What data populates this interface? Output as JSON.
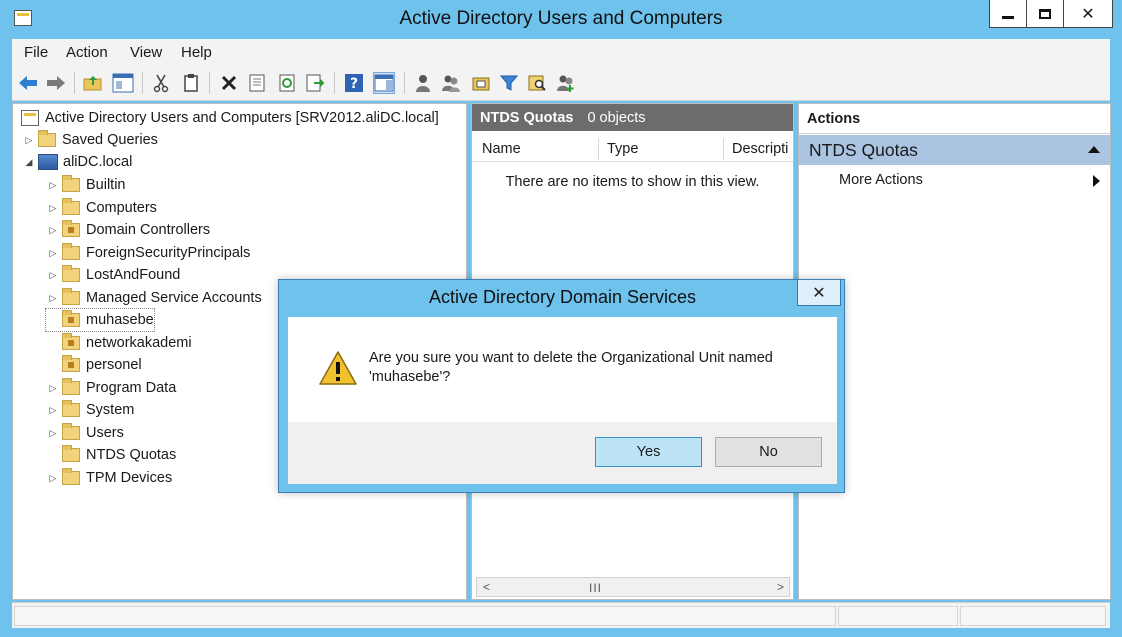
{
  "window": {
    "title": "Active Directory Users and Computers",
    "controls": {
      "minimize": "",
      "maximize": "",
      "close": "✕"
    }
  },
  "menubar": [
    "File",
    "Action",
    "View",
    "Help"
  ],
  "toolbar": {
    "icons": [
      "back-icon",
      "forward-icon",
      "up-folder-icon",
      "show-hide-console-tree-icon",
      "cut-icon",
      "copy-icon",
      "delete-icon",
      "properties-icon",
      "refresh-icon",
      "export-list-icon",
      "help-icon",
      "action-pane-icon",
      "new-user-icon",
      "new-group-icon",
      "new-ou-icon",
      "filter-icon",
      "find-icon",
      "add-to-group-icon"
    ]
  },
  "tree": {
    "root": "Active Directory Users and Computers [SRV2012.aliDC.local]",
    "saved_queries": "Saved Queries",
    "domain": "aliDC.local",
    "children": [
      {
        "label": "Builtin",
        "expandable": true,
        "ou": false
      },
      {
        "label": "Computers",
        "expandable": true,
        "ou": false
      },
      {
        "label": "Domain Controllers",
        "expandable": true,
        "ou": true
      },
      {
        "label": "ForeignSecurityPrincipals",
        "expandable": true,
        "ou": false
      },
      {
        "label": "LostAndFound",
        "expandable": true,
        "ou": false
      },
      {
        "label": "Managed Service Accounts",
        "expandable": true,
        "ou": false
      },
      {
        "label": "muhasebe",
        "expandable": false,
        "ou": true
      },
      {
        "label": "networkakademi",
        "expandable": false,
        "ou": true
      },
      {
        "label": "personel",
        "expandable": false,
        "ou": true
      },
      {
        "label": "Program Data",
        "expandable": true,
        "ou": false
      },
      {
        "label": "System",
        "expandable": true,
        "ou": false
      },
      {
        "label": "Users",
        "expandable": true,
        "ou": false
      },
      {
        "label": "NTDS Quotas",
        "expandable": false,
        "ou": false
      },
      {
        "label": "TPM Devices",
        "expandable": true,
        "ou": false
      }
    ]
  },
  "middle": {
    "header_title": "NTDS Quotas",
    "header_count": "0 objects",
    "columns": [
      "Name",
      "Type",
      "Descripti"
    ],
    "empty_message": "There are no items to show in this view.",
    "scroll_left": "<",
    "scroll_right": ">",
    "scroll_thumb": "III"
  },
  "actions": {
    "title": "Actions",
    "section": "NTDS Quotas",
    "more": "More Actions"
  },
  "dialog": {
    "title": "Active Directory Domain Services",
    "close": "✕",
    "message_line1": "Are you sure you want to delete the Organizational Unit named",
    "message_line2": "'muhasebe'?",
    "yes": "Yes",
    "no": "No"
  },
  "colors": {
    "title_bar": "#6fc2ec",
    "pane_header": "#6c6c6c",
    "actions_section": "#aac4e2",
    "default_button": "#bde3f7"
  }
}
